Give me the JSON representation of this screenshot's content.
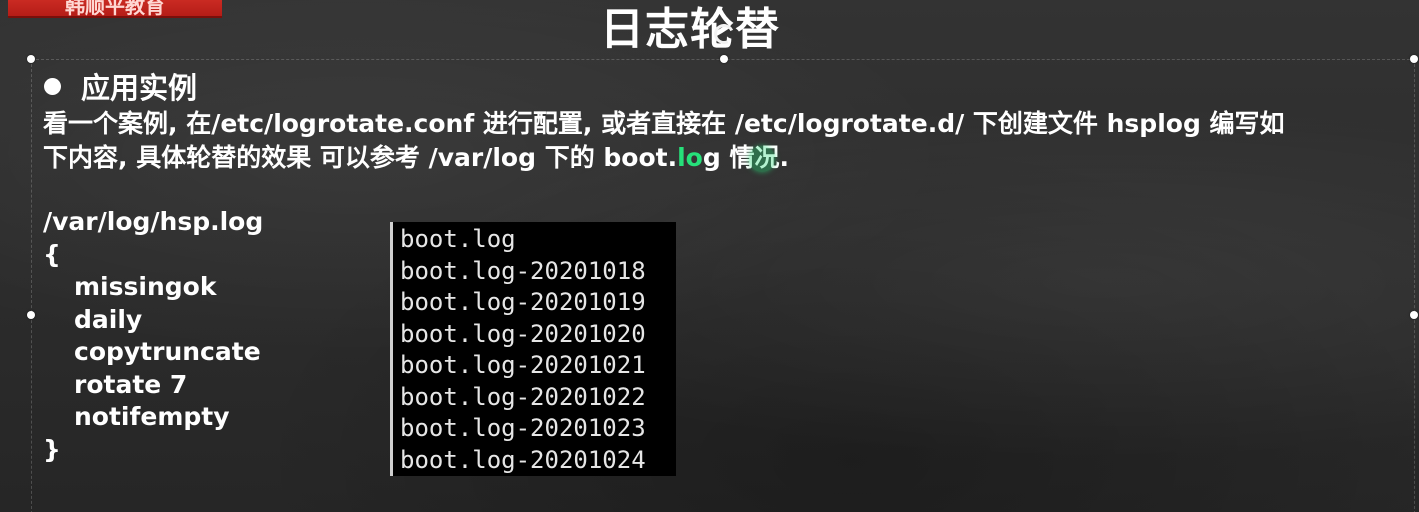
{
  "badge": {
    "text": "韩顺平教育"
  },
  "slide": {
    "title": "日志轮替",
    "section_heading": "应用实例",
    "description_line1": "看一个案例, 在/etc/logrotate.conf 进行配置, 或者直接在 /etc/logrotate.d/ 下创建文件 hsplog 编写如",
    "description_line2_a": "下内容, 具体轮替的效果 可以参考 /var/log 下的 boot.",
    "description_line2_hl": "lo",
    "description_line2_b": "g 情况."
  },
  "config": {
    "path": "/var/log/hsp.log",
    "open_brace": "{",
    "directives": [
      "missingok",
      "daily",
      "copytruncate",
      "rotate 7",
      "notifempty"
    ],
    "close_brace": "}"
  },
  "terminal": {
    "files": [
      "boot.log",
      "boot.log-20201018",
      "boot.log-20201019",
      "boot.log-20201020",
      "boot.log-20201021",
      "boot.log-20201022",
      "boot.log-20201023",
      "boot.log-20201024"
    ]
  },
  "colors": {
    "highlight": "#26e07a",
    "badge": "#c8251f",
    "background": "#2e2e2e"
  }
}
